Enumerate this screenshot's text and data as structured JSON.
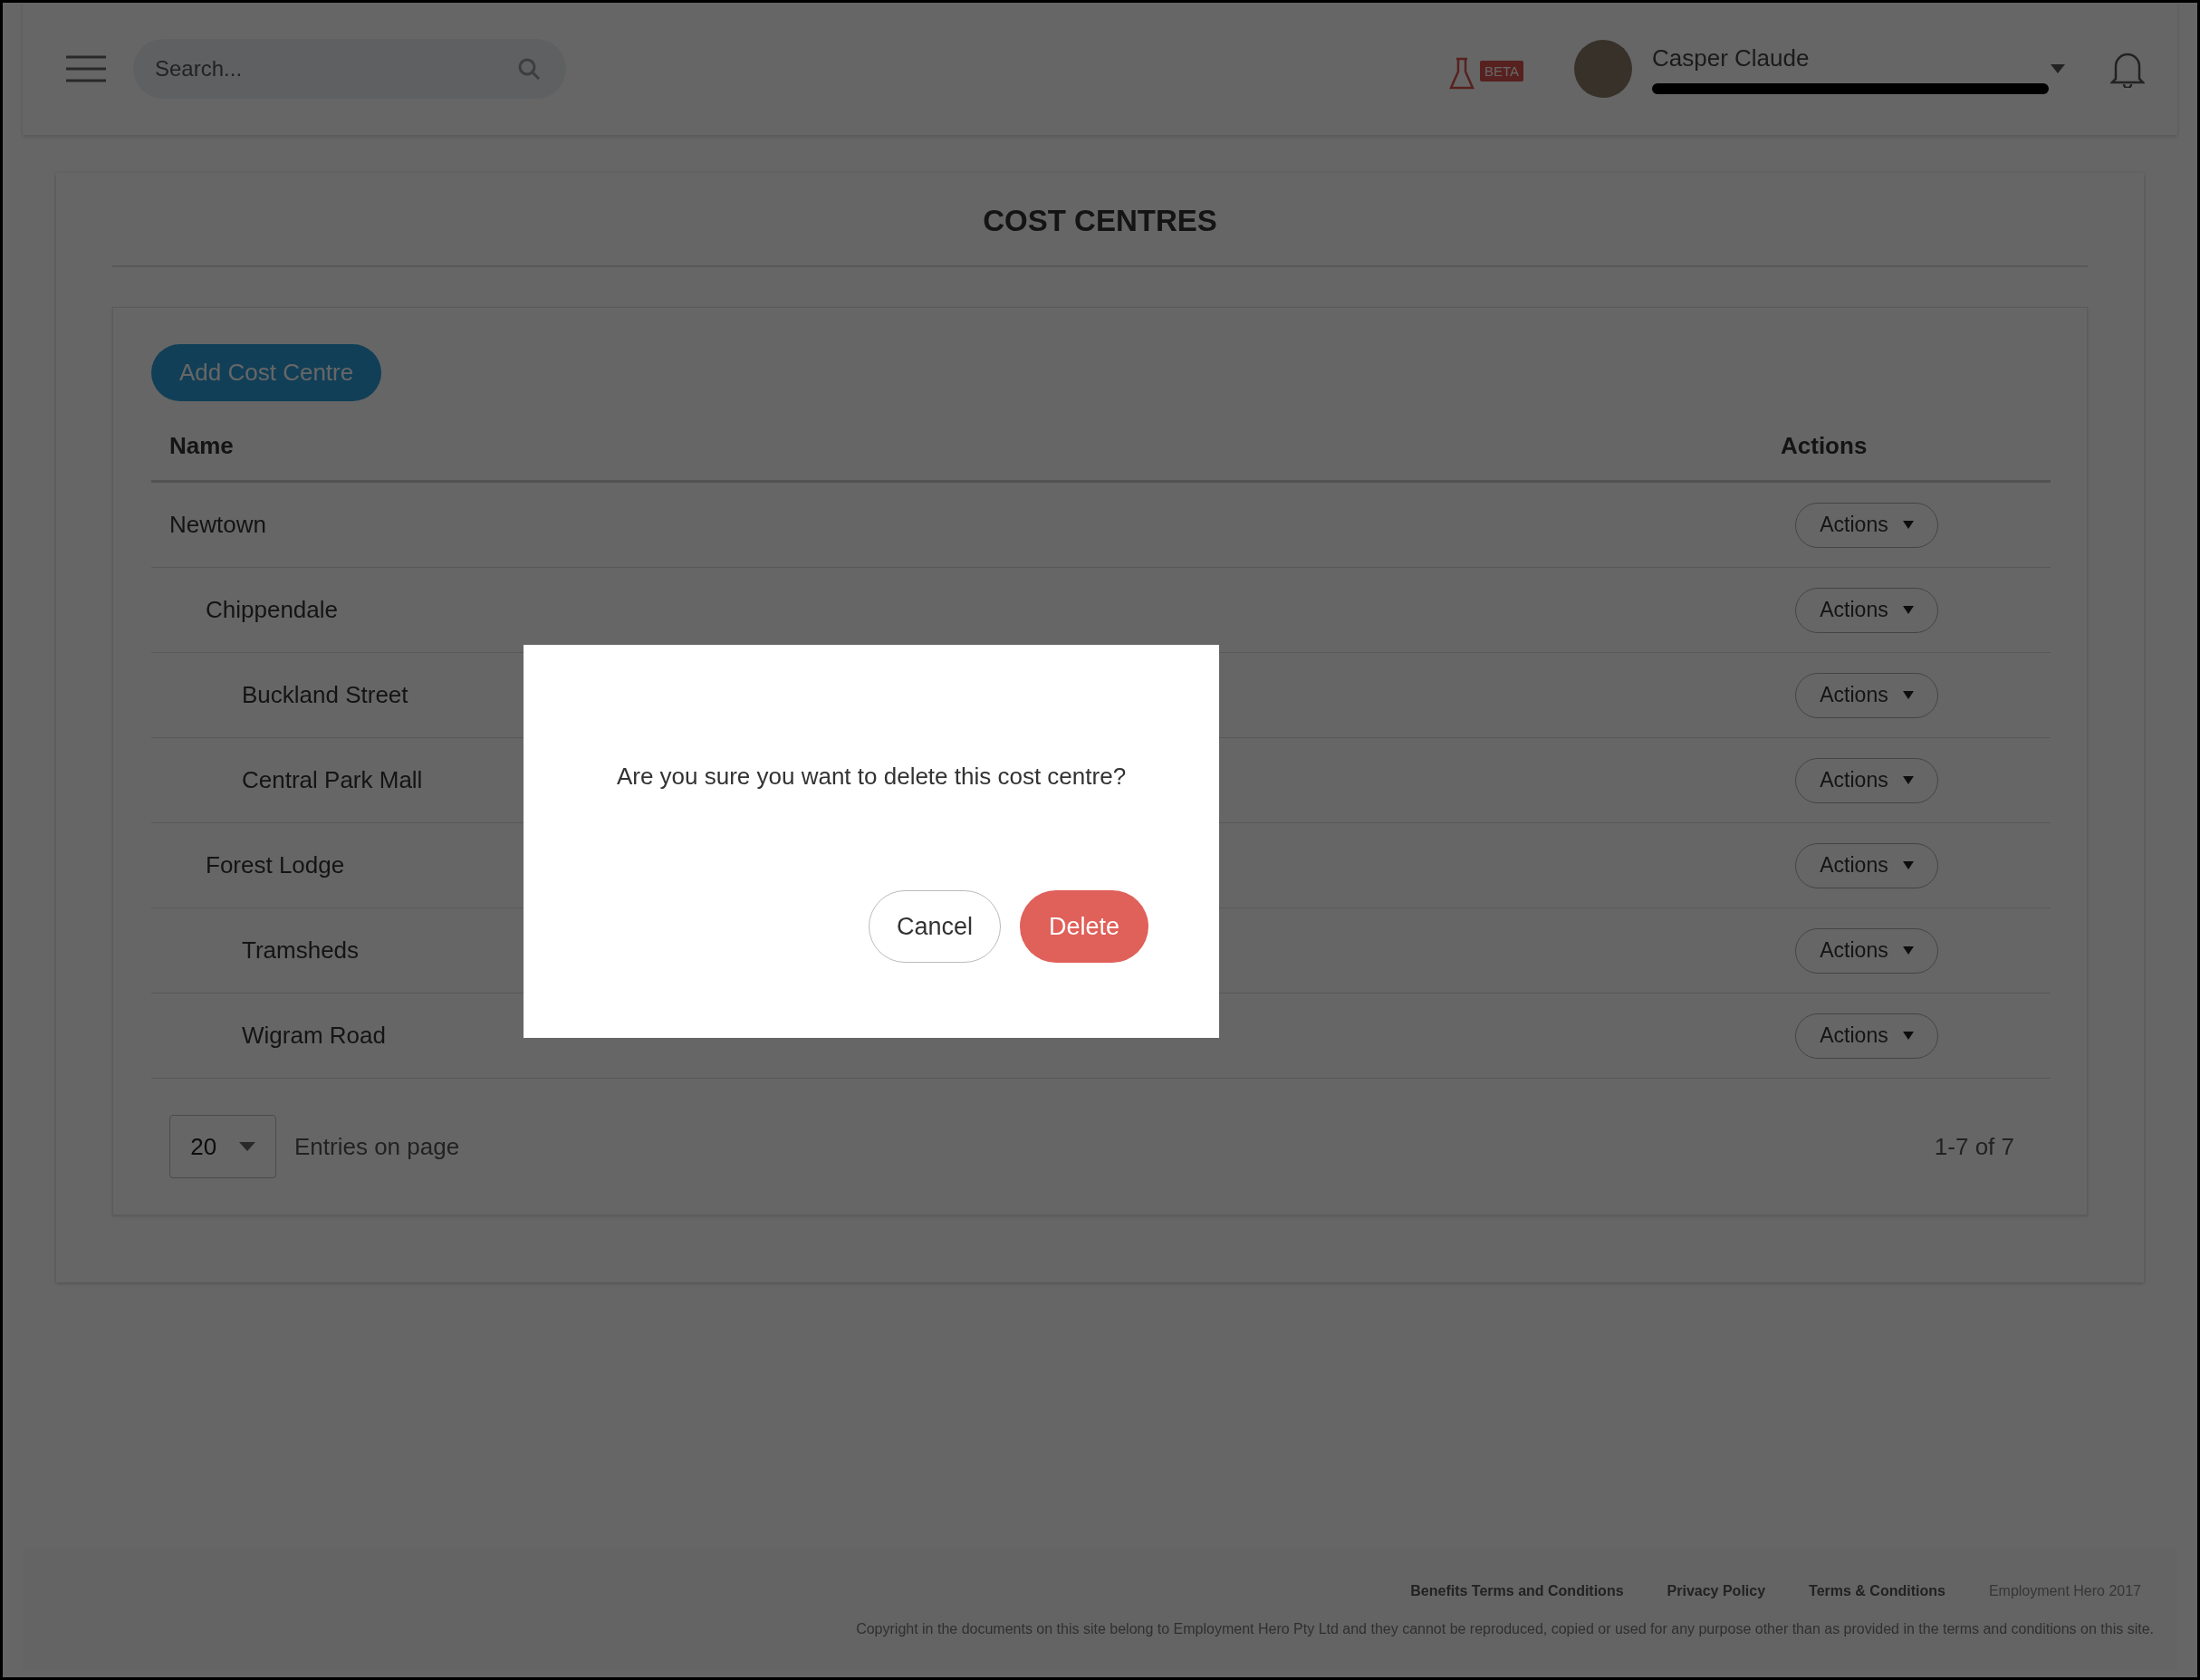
{
  "header": {
    "search": {
      "placeholder": "Search..."
    },
    "beta_badge": "BETA",
    "user": {
      "name": "Casper Claude"
    }
  },
  "page": {
    "title": "COST CENTRES",
    "add_button": "Add Cost Centre",
    "table": {
      "columns": [
        "Name",
        "Actions"
      ],
      "rows": [
        {
          "name": "Newtown",
          "action": "Actions",
          "children": [
            {
              "name": "Chippendale",
              "action": "Actions",
              "children": [
                {
                  "name": "Buckland Street",
                  "action": "Actions"
                },
                {
                  "name": "Central Park Mall",
                  "action": "Actions"
                }
              ]
            },
            {
              "name": "Forest Lodge",
              "action": "Actions",
              "children": [
                {
                  "name": "Tramsheds",
                  "action": "Actions"
                },
                {
                  "name": "Wigram Road",
                  "action": "Actions"
                }
              ]
            }
          ]
        }
      ]
    },
    "pagination": {
      "page_size": "20",
      "page_size_label": "Entries on page",
      "range": "1-7 of 7"
    }
  },
  "footer": {
    "links": [
      "Benefits Terms and Conditions",
      "Privacy Policy",
      "Terms & Conditions"
    ],
    "company": "Employment Hero 2017",
    "copyright": "Copyright in the documents on this site belong to Employment Hero Pty Ltd and they cannot be reproduced, copied or used for any purpose other than as provided in the terms and conditions on this site."
  },
  "modal": {
    "message": "Are you sure you want to delete this cost centre?",
    "buttons": [
      {
        "label": "Cancel",
        "kind": "secondary"
      },
      {
        "label": "Delete",
        "kind": "danger"
      }
    ]
  }
}
